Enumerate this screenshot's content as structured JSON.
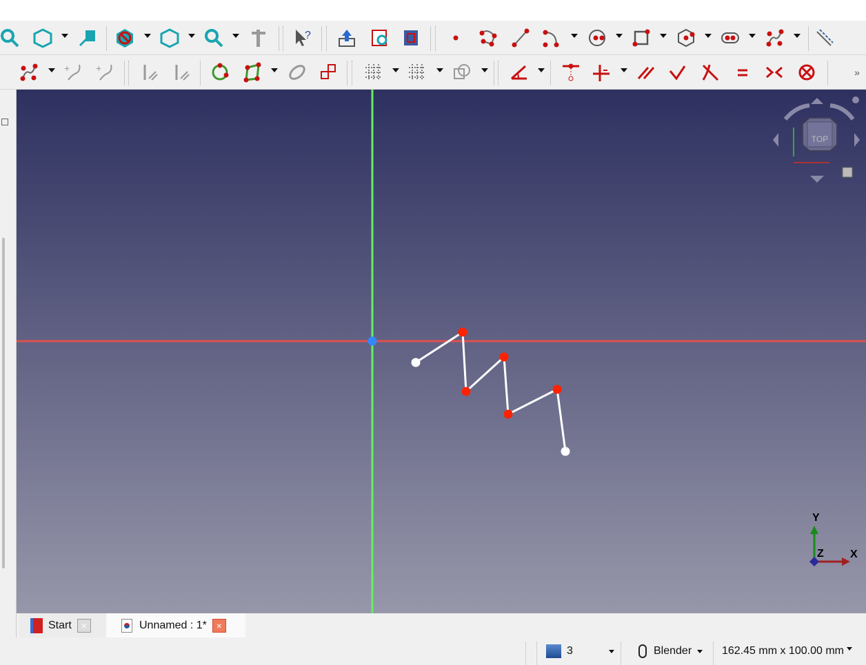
{
  "toolbar_row1": [
    "view-fit-icon",
    "view-isometric-icon",
    "view-menu-arrow",
    "sketch-view-icon",
    "draw-style-icon",
    "draw-style-arrow",
    "bounding-box-icon",
    "box-selection-arrow",
    "refresh-zoom-icon",
    "zoom-arrow",
    "measure-icon",
    "whats-this-icon",
    "leave-sketch-icon",
    "view-sketch-icon",
    "view-section-icon",
    "create-point-icon",
    "polyline-icon",
    "line-icon",
    "arc-icon",
    "arc-arrow",
    "circle-icon",
    "circle-arrow",
    "rectangle-icon",
    "rectangle-arrow",
    "polygon-icon",
    "polygon-arrow",
    "slot-icon",
    "slot-arrow",
    "bspline-icon",
    "bspline-arrow",
    "construction-mode-icon"
  ],
  "toolbar_row2": [
    "grid-hash-icon",
    "add-bspline-knot-icon",
    "bspline-arrow",
    "insert-knot-icon",
    "join-curves-icon",
    "symmetry-icon",
    "clone-icon",
    "circle-points-icon",
    "rectangular-array-icon",
    "array-arrow",
    "external-geometry-icon",
    "copy-icon",
    "show-grid-icon",
    "grid-arrow",
    "snap-icon",
    "snap-arrow",
    "rendering-order-icon",
    "order-arrow",
    "angle-constraint-icon",
    "angle-arrow",
    "point-on-object-icon",
    "horizontal-vertical-constraint-icon",
    "hv-arrow",
    "parallel-constraint-icon",
    "perpendicular-constraint-icon",
    "tangent-constraint-icon",
    "equal-constraint-icon",
    "symmetric-constraint-icon",
    "block-constraint-icon",
    "more-tools-icon"
  ],
  "more_label": "»",
  "navcube": {
    "face_label": "TOP"
  },
  "axis_indicator": {
    "x": "X",
    "y": "Y",
    "z": "Z"
  },
  "sketch": {
    "points": [
      [
        603,
        526,
        "end"
      ],
      [
        671,
        482,
        "vertex"
      ],
      [
        676,
        568,
        "vertex"
      ],
      [
        731,
        518,
        "vertex"
      ],
      [
        737,
        601,
        "vertex"
      ],
      [
        808,
        565,
        "vertex"
      ],
      [
        820,
        655,
        "end"
      ]
    ],
    "colors": {
      "vertex": "#ff2200",
      "end": "#ffffff",
      "line": "#ffffff",
      "x_axis": "#e05050",
      "y_axis": "#66ee66",
      "origin": "#3388ff"
    }
  },
  "tabs": [
    {
      "label": "Start",
      "close": "×"
    },
    {
      "label": "Unnamed : 1*",
      "close": "×"
    }
  ],
  "status": {
    "view_count": "3",
    "navigation_style": "Blender",
    "dimensions": "162.45 mm x 100.00 mm"
  }
}
